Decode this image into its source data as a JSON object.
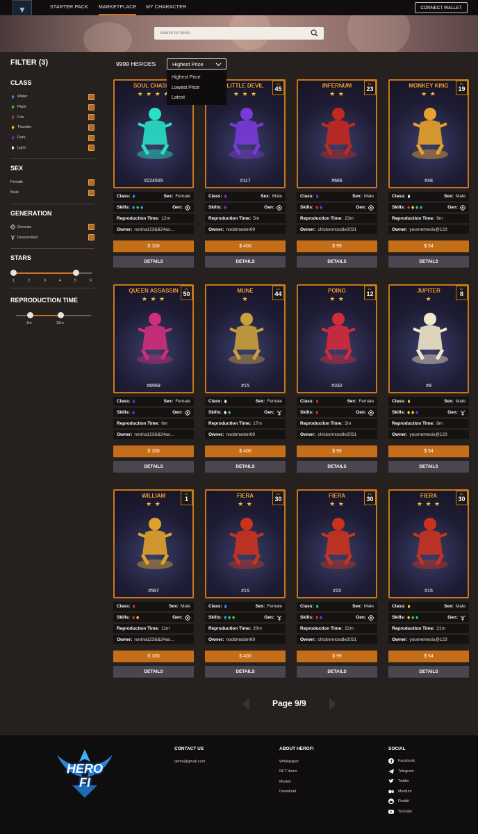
{
  "nav": {
    "items": [
      "STARTER PACK",
      "MARKETPLACE",
      "MY CHARACTER"
    ],
    "connect": "CONNECT WALLET"
  },
  "search": {
    "placeholder": "Search for items"
  },
  "filter": {
    "title": "FILTER  (3)",
    "class_title": "CLASS",
    "classes": [
      {
        "label": "Water",
        "color": "#3a8fe0"
      },
      {
        "label": "Plant",
        "color": "#34c759"
      },
      {
        "label": "Fire",
        "color": "#e02d2d"
      },
      {
        "label": "Thunder",
        "color": "#f4d21f"
      },
      {
        "label": "Dark",
        "color": "#8a2bd1"
      },
      {
        "label": "Light",
        "color": "#f5f5f5"
      }
    ],
    "sex_title": "SEX",
    "sexes": [
      "Female",
      "Male"
    ],
    "gen_title": "GENERATION",
    "generations": [
      "Genesis",
      "Descendant"
    ],
    "stars_title": "STARS",
    "stars_ticks": [
      "1",
      "2",
      "3",
      "4",
      "5",
      "6"
    ],
    "stars_range": [
      1,
      5
    ],
    "repro_title": "REPRODUCTION TIME",
    "repro_ticks": [
      "3m",
      "15m"
    ]
  },
  "list": {
    "count": "9999 HEROES",
    "sort": "Highest Price",
    "sort_options": [
      "Highest Price",
      "Lowest Price",
      "Latest"
    ]
  },
  "labels": {
    "class": "Class:",
    "sex": "Sex:",
    "skills": "Skills:",
    "gen": "Gen:",
    "repro": "Reproduction Time:",
    "owner": "Owner:",
    "details": "DETAILS",
    "lv": "Lv."
  },
  "cards": [
    {
      "name": "SOUL CHASER",
      "stars": "★ ★ ★ ★",
      "lv": "",
      "id": "#224555",
      "class_color": "#3a8fe0",
      "sex": "Female",
      "skills": [
        "#3a8fe0",
        "#34c759",
        "#3a8fe0"
      ],
      "gen": "genesis",
      "repro": "12m",
      "owner": "ronina123&&24as...",
      "price": "$ 100",
      "hero_color": "#28e0c8"
    },
    {
      "name": "LITTLE DEVIL",
      "stars": "★ ★ ★",
      "lv": "45",
      "id": "#117",
      "class_color": "#8a2bd1",
      "sex": "Male",
      "skills": [
        "#8a2bd1"
      ],
      "gen": "genesis",
      "repro": "5m",
      "owner": "noobmaster69",
      "price": "$ 400",
      "hero_color": "#7a3ad8"
    },
    {
      "name": "INFERNUM",
      "stars": "★ ★",
      "lv": "23",
      "id": "#666",
      "class_color": "#8a2bd1",
      "sex": "Male",
      "skills": [
        "#e02d2d",
        "#8a2bd1"
      ],
      "gen": "genesis",
      "repro": "23m",
      "owner": "chickennoodle2021",
      "price": "$ 99",
      "hero_color": "#c4281f"
    },
    {
      "name": "MONKEY KING",
      "stars": "★ ★",
      "lv": "19",
      "id": "#48",
      "class_color": "#f5f5f5",
      "sex": "Male",
      "skills": [
        "#e02d2d",
        "#f4d21f",
        "#34c759",
        "#3a8fe0"
      ],
      "gen": "genesis",
      "repro": "9m",
      "owner": "yournemesis@123",
      "price": "$ 54",
      "hero_color": "#e8a12c"
    },
    {
      "name": "QUEEN ASSASSIN",
      "stars": "★ ★ ★",
      "lv": "50",
      "id": "#6969",
      "class_color": "#8a2bd1",
      "sex": "Female",
      "skills": [
        "#8a2bd1"
      ],
      "gen": "genesis",
      "repro": "6m",
      "owner": "ronina123&&24as...",
      "price": "$ 100",
      "hero_color": "#d02d7a"
    },
    {
      "name": "MUNE",
      "stars": "★",
      "lv": "44",
      "id": "#15",
      "class_color": "#f5f5f5",
      "sex": "Female",
      "skills": [
        "#f5f5f5",
        "#34c759"
      ],
      "gen": "descendant",
      "repro": "17m",
      "owner": "noobmaster69",
      "price": "$ 400",
      "hero_color": "#caa03a"
    },
    {
      "name": "POING",
      "stars": "★ ★",
      "lv": "12",
      "id": "#332",
      "class_color": "#e02d2d",
      "sex": "Female",
      "skills": [
        "#e02d2d"
      ],
      "gen": "genesis",
      "repro": "2m",
      "owner": "chickennoodle2021",
      "price": "$ 99",
      "hero_color": "#d42a3a"
    },
    {
      "name": "JUPITER",
      "stars": "★",
      "lv": "8",
      "id": "#9",
      "class_color": "#f4d21f",
      "sex": "Male",
      "skills": [
        "#f4d21f",
        "#f4d21f",
        "#8a2bd1"
      ],
      "gen": "descendant",
      "repro": "8m",
      "owner": "yournemesis@123",
      "price": "$ 54",
      "hero_color": "#f0e6c8"
    },
    {
      "name": "WILLIAM",
      "stars": "★ ★",
      "lv": "1",
      "id": "#567",
      "class_color": "#e02d2d",
      "sex": "Male",
      "skills": [
        "#e02d2d",
        "#f4d21f"
      ],
      "gen": "genesis",
      "repro": "11m",
      "owner": "ronina123&&24as...",
      "price": "$ 100",
      "hero_color": "#e0a22a"
    },
    {
      "name": "FIERA",
      "stars": "★ ★",
      "lv": "30",
      "id": "#15",
      "class_color": "#3a8fe0",
      "sex": "Female",
      "skills": [
        "#3a8fe0",
        "#34c759",
        "#34c759"
      ],
      "gen": "descendant",
      "repro": "20m",
      "owner": "noobmaster69",
      "price": "$ 400",
      "hero_color": "#c9331e"
    },
    {
      "name": "FIERA",
      "stars": "★ ★",
      "lv": "30",
      "id": "#15",
      "class_color": "#34c759",
      "sex": "Male",
      "skills": [
        "#e02d2d",
        "#8a2bd1"
      ],
      "gen": "genesis",
      "repro": "22m",
      "owner": "chickennoodle2021",
      "price": "$ 99",
      "hero_color": "#c9331e"
    },
    {
      "name": "FIERA",
      "stars": "★ ★ ★",
      "lv": "30",
      "id": "#15",
      "class_color": "#f4d21f",
      "sex": "Male",
      "skills": [
        "#f4d21f",
        "#34c759",
        "#34c759"
      ],
      "gen": "descendant",
      "repro": "21m",
      "owner": "yournemesis@123",
      "price": "$ 54",
      "hero_color": "#c9331e"
    }
  ],
  "pagination": {
    "label": "Page 9/9"
  },
  "footer": {
    "logo_text": [
      "HERO",
      "FI"
    ],
    "contact_title": "CONTACT US",
    "email": "demo@gmail.com",
    "about_title": "ABOUT HEROFI",
    "about_links": [
      "Whitepaper",
      "NFT Items",
      "Market",
      "Download"
    ],
    "social_title": "SOCIAL",
    "social_links": [
      "Facebook",
      "Telegram",
      "Twitter",
      "Medium",
      "Reddit",
      "Youtube"
    ]
  }
}
